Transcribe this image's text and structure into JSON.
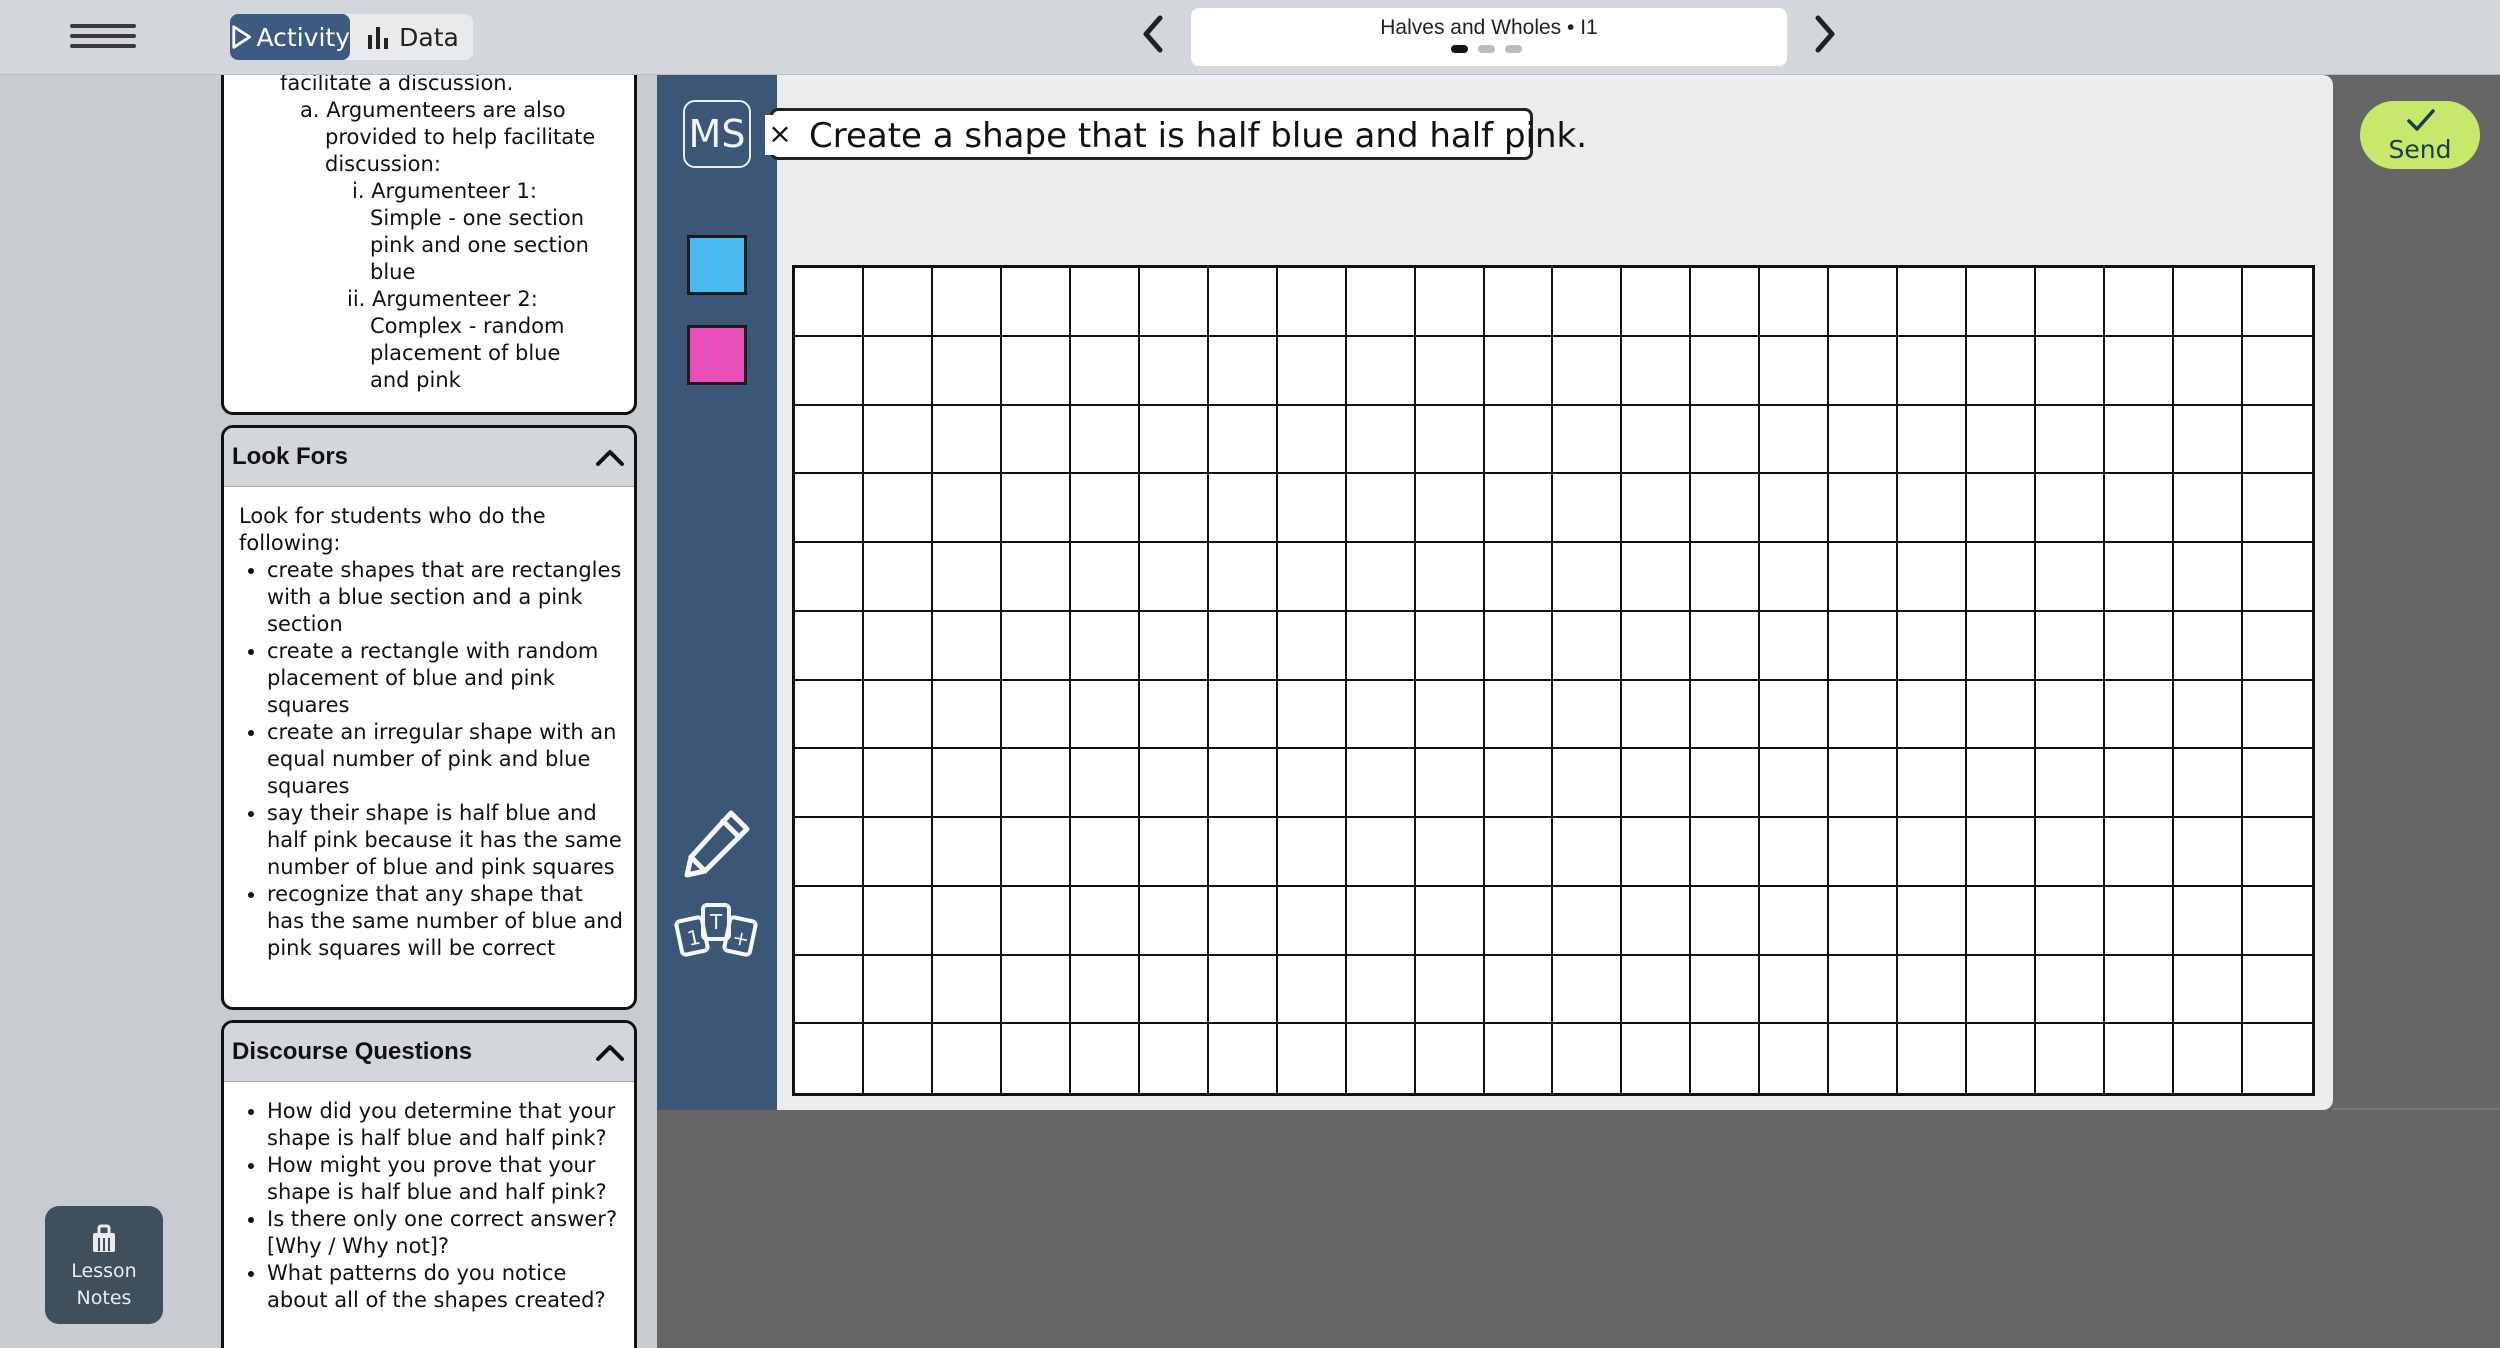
{
  "topbar": {
    "tabs": [
      {
        "label": "Activity",
        "icon": "play-icon",
        "active": true
      },
      {
        "label": "Data",
        "icon": "bar-chart-icon",
        "active": false
      }
    ],
    "title": "Halves and Wholes • I1",
    "pager": {
      "total": 3,
      "current": 1
    }
  },
  "left_rail": {
    "lesson_notes_label_1": "Lesson",
    "lesson_notes_label_2": "Notes",
    "icon": "clipboard-icon"
  },
  "notes": {
    "card1_lines": [
      "facilitate a discussion.",
      "a. Argumenteers are also",
      "provided to help facilitate",
      "discussion:",
      "i. Argumenteer 1:",
      "Simple - one section",
      "pink and one section",
      "blue",
      "ii. Argumenteer 2:",
      "Complex - random",
      "placement of blue",
      "and pink"
    ],
    "look_fors": {
      "title": "Look Fors",
      "intro": "Look for students who do the following:",
      "items": [
        "create shapes that are rectangles with a blue section and a pink section",
        "create a rectangle with random placement of blue and pink squares",
        "create an irregular shape with an equal number of pink and blue squares",
        "say their shape is half blue and half pink because it has the same number of blue and pink squares",
        "recognize that any shape that has the same number of blue and pink squares will be correct"
      ]
    },
    "discourse": {
      "title": "Discourse Questions",
      "items": [
        "How did you determine that your shape is half blue and half pink?",
        "How might you prove that your shape is half blue and half pink?",
        "Is there only one correct answer? [Why / Why not]?",
        "What patterns do you notice about all of the shapes created?"
      ]
    }
  },
  "activity": {
    "student_initials": "MS",
    "prompt": "Create a shape that is half blue and half pink.",
    "colors": {
      "blue": "#4bb9ef",
      "pink": "#e94fb8",
      "toolbar": "#3c5678"
    },
    "grid": {
      "columns": 22,
      "rows": 12
    },
    "send_label": "Send"
  }
}
